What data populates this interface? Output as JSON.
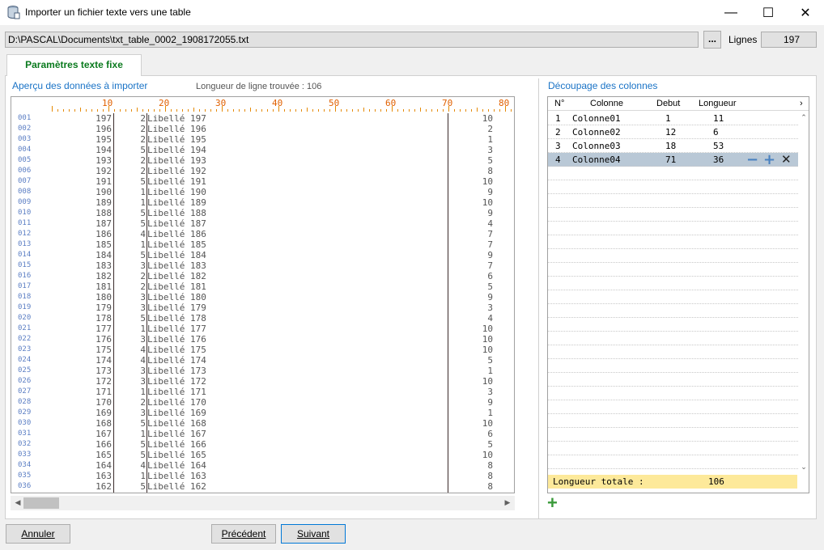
{
  "window": {
    "title": "Importer un fichier texte vers une table",
    "min": "—",
    "max": "☐",
    "close": "✕"
  },
  "file": {
    "path": "D:\\PASCAL\\Documents\\txt_table_0002_1908172055.txt",
    "browse_label": "...",
    "lines_label": "Lignes",
    "lines_value": "197"
  },
  "tab": {
    "label": "Paramètres texte fixe"
  },
  "preview": {
    "title": "Aperçu des données à importer",
    "line_length_text": "Longueur de ligne trouvée : 106",
    "ruler_numbers": [
      "10",
      "20",
      "30",
      "40",
      "50",
      "60",
      "70",
      "80"
    ],
    "rows": [
      {
        "n": "001",
        "c1": "197",
        "c2": "2",
        "c3": "Libellé 197",
        "c4": "10"
      },
      {
        "n": "002",
        "c1": "196",
        "c2": "2",
        "c3": "Libellé 196",
        "c4": "2"
      },
      {
        "n": "003",
        "c1": "195",
        "c2": "2",
        "c3": "Libellé 195",
        "c4": "1"
      },
      {
        "n": "004",
        "c1": "194",
        "c2": "5",
        "c3": "Libellé 194",
        "c4": "3"
      },
      {
        "n": "005",
        "c1": "193",
        "c2": "2",
        "c3": "Libellé 193",
        "c4": "5"
      },
      {
        "n": "006",
        "c1": "192",
        "c2": "2",
        "c3": "Libellé 192",
        "c4": "8"
      },
      {
        "n": "007",
        "c1": "191",
        "c2": "5",
        "c3": "Libellé 191",
        "c4": "10"
      },
      {
        "n": "008",
        "c1": "190",
        "c2": "1",
        "c3": "Libellé 190",
        "c4": "9"
      },
      {
        "n": "009",
        "c1": "189",
        "c2": "1",
        "c3": "Libellé 189",
        "c4": "10"
      },
      {
        "n": "010",
        "c1": "188",
        "c2": "5",
        "c3": "Libellé 188",
        "c4": "9"
      },
      {
        "n": "011",
        "c1": "187",
        "c2": "5",
        "c3": "Libellé 187",
        "c4": "4"
      },
      {
        "n": "012",
        "c1": "186",
        "c2": "4",
        "c3": "Libellé 186",
        "c4": "7"
      },
      {
        "n": "013",
        "c1": "185",
        "c2": "1",
        "c3": "Libellé 185",
        "c4": "7"
      },
      {
        "n": "014",
        "c1": "184",
        "c2": "5",
        "c3": "Libellé 184",
        "c4": "9"
      },
      {
        "n": "015",
        "c1": "183",
        "c2": "3",
        "c3": "Libellé 183",
        "c4": "7"
      },
      {
        "n": "016",
        "c1": "182",
        "c2": "2",
        "c3": "Libellé 182",
        "c4": "6"
      },
      {
        "n": "017",
        "c1": "181",
        "c2": "2",
        "c3": "Libellé 181",
        "c4": "5"
      },
      {
        "n": "018",
        "c1": "180",
        "c2": "3",
        "c3": "Libellé 180",
        "c4": "9"
      },
      {
        "n": "019",
        "c1": "179",
        "c2": "3",
        "c3": "Libellé 179",
        "c4": "3"
      },
      {
        "n": "020",
        "c1": "178",
        "c2": "5",
        "c3": "Libellé 178",
        "c4": "4"
      },
      {
        "n": "021",
        "c1": "177",
        "c2": "1",
        "c3": "Libellé 177",
        "c4": "10"
      },
      {
        "n": "022",
        "c1": "176",
        "c2": "3",
        "c3": "Libellé 176",
        "c4": "10"
      },
      {
        "n": "023",
        "c1": "175",
        "c2": "4",
        "c3": "Libellé 175",
        "c4": "10"
      },
      {
        "n": "024",
        "c1": "174",
        "c2": "4",
        "c3": "Libellé 174",
        "c4": "5"
      },
      {
        "n": "025",
        "c1": "173",
        "c2": "3",
        "c3": "Libellé 173",
        "c4": "1"
      },
      {
        "n": "026",
        "c1": "172",
        "c2": "3",
        "c3": "Libellé 172",
        "c4": "10"
      },
      {
        "n": "027",
        "c1": "171",
        "c2": "1",
        "c3": "Libellé 171",
        "c4": "3"
      },
      {
        "n": "028",
        "c1": "170",
        "c2": "2",
        "c3": "Libellé 170",
        "c4": "9"
      },
      {
        "n": "029",
        "c1": "169",
        "c2": "3",
        "c3": "Libellé 169",
        "c4": "1"
      },
      {
        "n": "030",
        "c1": "168",
        "c2": "5",
        "c3": "Libellé 168",
        "c4": "10"
      },
      {
        "n": "031",
        "c1": "167",
        "c2": "1",
        "c3": "Libellé 167",
        "c4": "6"
      },
      {
        "n": "032",
        "c1": "166",
        "c2": "5",
        "c3": "Libellé 166",
        "c4": "5"
      },
      {
        "n": "033",
        "c1": "165",
        "c2": "5",
        "c3": "Libellé 165",
        "c4": "10"
      },
      {
        "n": "034",
        "c1": "164",
        "c2": "4",
        "c3": "Libellé 164",
        "c4": "8"
      },
      {
        "n": "035",
        "c1": "163",
        "c2": "1",
        "c3": "Libellé 163",
        "c4": "8"
      },
      {
        "n": "036",
        "c1": "162",
        "c2": "5",
        "c3": "Libellé 162",
        "c4": "8"
      }
    ]
  },
  "columns": {
    "title": "Découpage des colonnes",
    "headers": {
      "num": "N°",
      "name": "Colonne",
      "start": "Debut",
      "length": "Longueur"
    },
    "rows": [
      {
        "num": "1",
        "name": "Colonne01",
        "start": "1",
        "length": "11"
      },
      {
        "num": "2",
        "name": "Colonne02",
        "start": "12",
        "length": "6"
      },
      {
        "num": "3",
        "name": "Colonne03",
        "start": "18",
        "length": "53"
      },
      {
        "num": "4",
        "name": "Colonne04",
        "start": "71",
        "length": "36"
      }
    ],
    "row_actions": {
      "minus": "−",
      "plus": "+",
      "delete": "✕"
    },
    "total_label": "Longueur totale :",
    "total_value": "106",
    "add_label": "+"
  },
  "buttons": {
    "cancel": "Annuler",
    "previous": "Précédent",
    "next": "Suivant"
  },
  "colors": {
    "accent_blue": "#1a73c6",
    "tab_green": "#0a7a1e",
    "ruler_orange": "#e06000",
    "total_yellow": "#fde99a",
    "selected_row": "#b9c8d6"
  }
}
